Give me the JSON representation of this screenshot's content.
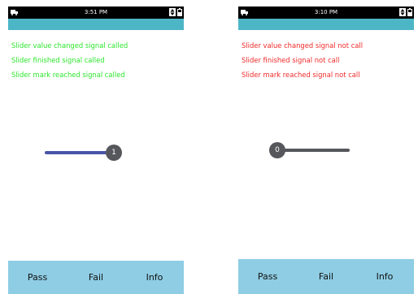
{
  "colors": {
    "status_bar": "#000000",
    "title_band": "#4db6c6",
    "bottom_bar": "#8ecde4",
    "signal_called": "#2ee62e",
    "signal_not_called": "#f02a2a",
    "slider_track_filled": "#4a54a8",
    "slider_track_default": "#55575c",
    "slider_handle": "#55575c"
  },
  "left": {
    "status": {
      "time": "3:51 PM"
    },
    "signals": [
      "Slider value changed signal called",
      "Slider finished signal called",
      "Slider mark reached signal called"
    ],
    "slider": {
      "value": 1,
      "label": "1",
      "fraction": 1.0
    },
    "buttons": {
      "pass": "Pass",
      "fail": "Fail",
      "info": "Info"
    }
  },
  "right": {
    "status": {
      "time": "3:10 PM"
    },
    "signals": [
      "Slider value changed signal not call",
      "Slider finished signal not call",
      "Slider mark reached signal not call"
    ],
    "slider": {
      "value": 0,
      "label": "0",
      "fraction": 0.0
    },
    "buttons": {
      "pass": "Pass",
      "fail": "Fail",
      "info": "Info"
    }
  }
}
